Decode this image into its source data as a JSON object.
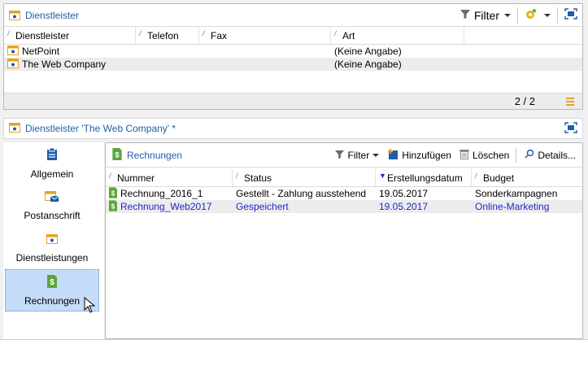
{
  "top_panel": {
    "title": "Dienstleister",
    "filter_label": "Filter",
    "columns": [
      "Dienstleister",
      "Telefon",
      "Fax",
      "Art"
    ],
    "rows": [
      {
        "name": "NetPoint",
        "telefon": "",
        "fax": "",
        "art": "(Keine Angabe)"
      },
      {
        "name": "The Web Company",
        "telefon": "",
        "fax": "",
        "art": "(Keine Angabe)"
      }
    ],
    "count": "2 / 2"
  },
  "detail_panel": {
    "title": "Dienstleister 'The Web Company' *",
    "nav": [
      {
        "label": "Allgemein",
        "icon": "clipboard-icon"
      },
      {
        "label": "Postanschrift",
        "icon": "mail-icon"
      },
      {
        "label": "Dienstleistungen",
        "icon": "service-icon"
      },
      {
        "label": "Rechnungen",
        "icon": "invoice-icon"
      }
    ],
    "toolbar": {
      "tab_label": "Rechnungen",
      "filter_label": "Filter",
      "add_label": "Hinzufügen",
      "delete_label": "Löschen",
      "details_label": "Details..."
    },
    "columns": [
      "Nummer",
      "Status",
      "Erstellungsdatum",
      "Budget"
    ],
    "rows": [
      {
        "nummer": "Rechnung_2016_1",
        "status": "Gestellt - Zahlung ausstehend",
        "datum": "19.05.2017",
        "budget": "Sonderkampagnen"
      },
      {
        "nummer": "Rechnung_Web2017",
        "status": "Gespeichert",
        "datum": "19.05.2017",
        "budget": "Online-Marketing"
      }
    ]
  },
  "colors": {
    "accent": "#1f5ea8",
    "selected_nav": "#c5dcf8",
    "selected_row_text": "#1f28c8",
    "invoice_green": "#5aa63a",
    "orange": "#e8a31a"
  }
}
